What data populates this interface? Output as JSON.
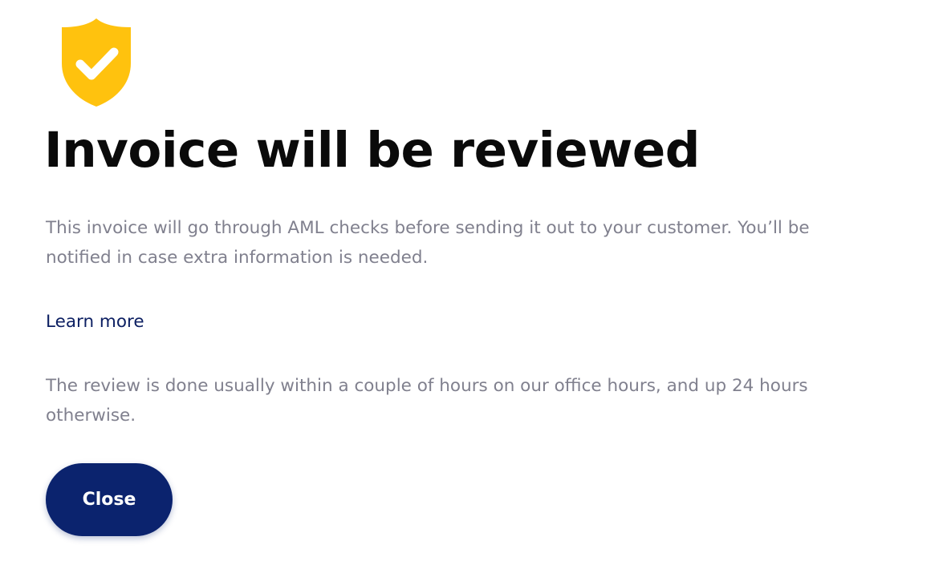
{
  "dialog": {
    "icon": "shield-check-icon",
    "icon_color": "#FFC20E",
    "title": "Invoice will be reviewed",
    "paragraph_1": "This invoice will go through AML checks before sending it out to your customer. You’ll be notified in case extra information is needed.",
    "learn_more_label": "Learn more",
    "paragraph_2": "The review is done usually within a couple of hours on our office hours, and up 24 hours otherwise.",
    "close_label": "Close"
  },
  "colors": {
    "title": "#0A0A0A",
    "body_text": "#80808E",
    "link": "#0C1F62",
    "button_bg": "#0B236E",
    "button_text": "#FFFFFF"
  }
}
